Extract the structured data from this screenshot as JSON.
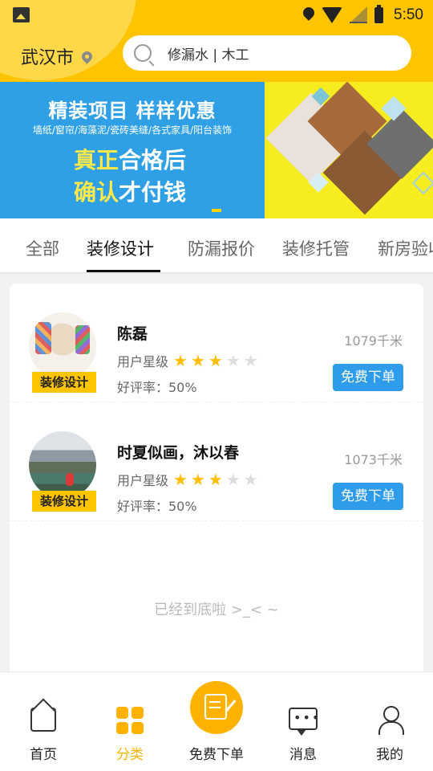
{
  "status_bar": {
    "time": "5:50"
  },
  "header": {
    "city": "武汉市",
    "search_placeholder": "修漏水 | 木工"
  },
  "banner": {
    "title": "精装项目  样样优惠",
    "subtitle": "墙纸/窗帘/海藻泥/瓷砖美缝/各式家具/阳台装饰",
    "line1_highlight": "真正",
    "line1_rest": "合格后",
    "line2_highlight": "确认",
    "line2_rest": "才付钱"
  },
  "tabs": [
    {
      "label": "全部"
    },
    {
      "label": "装修设计"
    },
    {
      "label": "防漏报价"
    },
    {
      "label": "装修托管"
    },
    {
      "label": "新房验收"
    }
  ],
  "active_tab": "装修设计",
  "designers": [
    {
      "name": "陈磊",
      "tag": "装修设计",
      "level_label": "用户星级",
      "stars": 3,
      "max_stars": 5,
      "rating": "好评率：50%",
      "distance": "1079千米",
      "button": "免费下单"
    },
    {
      "name": "时夏似画，沐以春",
      "tag": "装修设计",
      "level_label": "用户星级",
      "stars": 3,
      "max_stars": 5,
      "rating": "好评率：50%",
      "distance": "1073千米",
      "button": "免费下单"
    }
  ],
  "list_end_text": "已经到底啦 >_< ~",
  "bottom_nav": [
    {
      "label": "首页",
      "icon": "home-icon",
      "active": false
    },
    {
      "label": "分类",
      "icon": "category-icon",
      "active": true
    },
    {
      "label": "免费下单",
      "icon": "order-edit-icon",
      "active": false
    },
    {
      "label": "消息",
      "icon": "message-icon",
      "active": false
    },
    {
      "label": "我的",
      "icon": "user-icon",
      "active": false
    }
  ],
  "colors": {
    "brand_yellow": "#ffc400",
    "accent_orange": "#ffb300",
    "button_blue": "#2e9cea",
    "banner_blue": "#2fa0e6"
  }
}
